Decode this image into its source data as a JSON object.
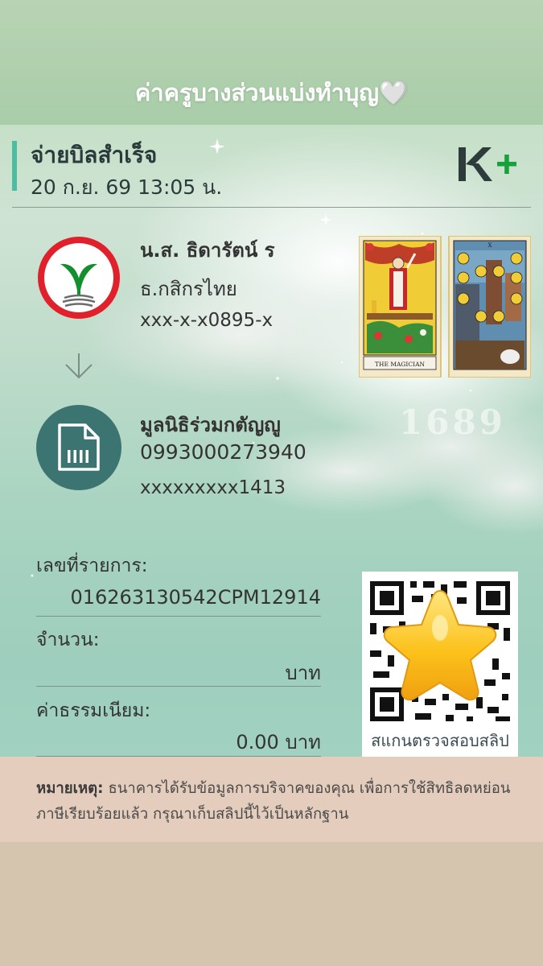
{
  "caption": "ค่าครูบางส่วนแบ่งทำบุญ🤍",
  "header": {
    "title": "จ่ายบิลสำเร็จ",
    "datetime": "20 ก.ย. 69  13:05 น.",
    "brand_logo": "K+"
  },
  "sender": {
    "name": "น.ส. ธิดารัตน์ ร",
    "bank": "ธ.กสิกรไทย",
    "account": "xxx-x-x0895-x",
    "logo_icon": "kasikorn-bank-logo"
  },
  "arrow_icon": "arrow-down-icon",
  "receiver": {
    "name": "มูลนิธิร่วมกตัญญู",
    "biller_id": "0993000273940",
    "reference": "xxxxxxxxx1413",
    "icon": "bill-document-icon"
  },
  "tarot": {
    "card1_caption": "THE MAGICIAN",
    "card2_caption": "X",
    "number": "1689"
  },
  "fields": {
    "ref_label": "เลขที่รายการ:",
    "ref_value": "016263130542CPM12914",
    "amount_label": "จำนวน:",
    "amount_value": "บาท",
    "fee_label": "ค่าธรรมเนียม:",
    "fee_value": "0.00 บาท"
  },
  "qr": {
    "caption": "สแกนตรวจสอบสลิป",
    "overlay_icon": "star-emoji"
  },
  "note": {
    "label": "หมายเหตุ:",
    "text": "ธนาคารได้รับข้อมูลการบริจาคของคุณ เพื่อการใช้สิทธิลดหย่อนภาษีเรียบร้อยแล้ว กรุณาเก็บสลิปนี้ไว้เป็นหลักฐาน"
  },
  "colors": {
    "accent": "#4bbda0",
    "kbank_green": "#138f2d",
    "kbank_red": "#e0202a",
    "receiver_icon_bg": "#3c7472",
    "note_bg": "#e4cdbd"
  }
}
